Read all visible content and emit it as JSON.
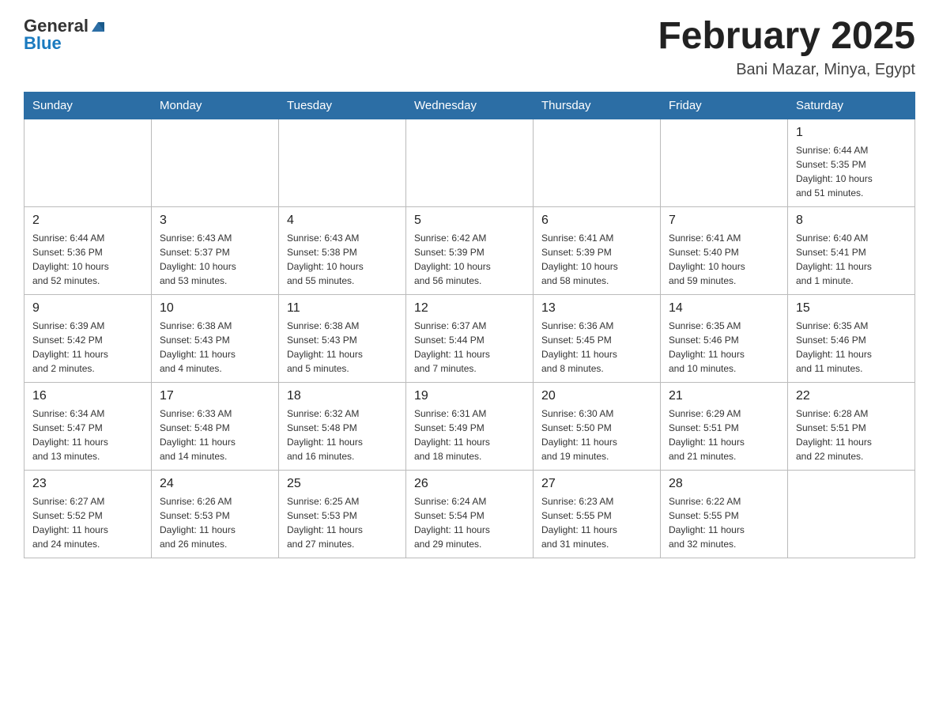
{
  "header": {
    "logo_general": "General",
    "logo_blue": "Blue",
    "title": "February 2025",
    "location": "Bani Mazar, Minya, Egypt"
  },
  "weekdays": [
    "Sunday",
    "Monday",
    "Tuesday",
    "Wednesday",
    "Thursday",
    "Friday",
    "Saturday"
  ],
  "weeks": [
    [
      {
        "day": "",
        "info": ""
      },
      {
        "day": "",
        "info": ""
      },
      {
        "day": "",
        "info": ""
      },
      {
        "day": "",
        "info": ""
      },
      {
        "day": "",
        "info": ""
      },
      {
        "day": "",
        "info": ""
      },
      {
        "day": "1",
        "info": "Sunrise: 6:44 AM\nSunset: 5:35 PM\nDaylight: 10 hours\nand 51 minutes."
      }
    ],
    [
      {
        "day": "2",
        "info": "Sunrise: 6:44 AM\nSunset: 5:36 PM\nDaylight: 10 hours\nand 52 minutes."
      },
      {
        "day": "3",
        "info": "Sunrise: 6:43 AM\nSunset: 5:37 PM\nDaylight: 10 hours\nand 53 minutes."
      },
      {
        "day": "4",
        "info": "Sunrise: 6:43 AM\nSunset: 5:38 PM\nDaylight: 10 hours\nand 55 minutes."
      },
      {
        "day": "5",
        "info": "Sunrise: 6:42 AM\nSunset: 5:39 PM\nDaylight: 10 hours\nand 56 minutes."
      },
      {
        "day": "6",
        "info": "Sunrise: 6:41 AM\nSunset: 5:39 PM\nDaylight: 10 hours\nand 58 minutes."
      },
      {
        "day": "7",
        "info": "Sunrise: 6:41 AM\nSunset: 5:40 PM\nDaylight: 10 hours\nand 59 minutes."
      },
      {
        "day": "8",
        "info": "Sunrise: 6:40 AM\nSunset: 5:41 PM\nDaylight: 11 hours\nand 1 minute."
      }
    ],
    [
      {
        "day": "9",
        "info": "Sunrise: 6:39 AM\nSunset: 5:42 PM\nDaylight: 11 hours\nand 2 minutes."
      },
      {
        "day": "10",
        "info": "Sunrise: 6:38 AM\nSunset: 5:43 PM\nDaylight: 11 hours\nand 4 minutes."
      },
      {
        "day": "11",
        "info": "Sunrise: 6:38 AM\nSunset: 5:43 PM\nDaylight: 11 hours\nand 5 minutes."
      },
      {
        "day": "12",
        "info": "Sunrise: 6:37 AM\nSunset: 5:44 PM\nDaylight: 11 hours\nand 7 minutes."
      },
      {
        "day": "13",
        "info": "Sunrise: 6:36 AM\nSunset: 5:45 PM\nDaylight: 11 hours\nand 8 minutes."
      },
      {
        "day": "14",
        "info": "Sunrise: 6:35 AM\nSunset: 5:46 PM\nDaylight: 11 hours\nand 10 minutes."
      },
      {
        "day": "15",
        "info": "Sunrise: 6:35 AM\nSunset: 5:46 PM\nDaylight: 11 hours\nand 11 minutes."
      }
    ],
    [
      {
        "day": "16",
        "info": "Sunrise: 6:34 AM\nSunset: 5:47 PM\nDaylight: 11 hours\nand 13 minutes."
      },
      {
        "day": "17",
        "info": "Sunrise: 6:33 AM\nSunset: 5:48 PM\nDaylight: 11 hours\nand 14 minutes."
      },
      {
        "day": "18",
        "info": "Sunrise: 6:32 AM\nSunset: 5:48 PM\nDaylight: 11 hours\nand 16 minutes."
      },
      {
        "day": "19",
        "info": "Sunrise: 6:31 AM\nSunset: 5:49 PM\nDaylight: 11 hours\nand 18 minutes."
      },
      {
        "day": "20",
        "info": "Sunrise: 6:30 AM\nSunset: 5:50 PM\nDaylight: 11 hours\nand 19 minutes."
      },
      {
        "day": "21",
        "info": "Sunrise: 6:29 AM\nSunset: 5:51 PM\nDaylight: 11 hours\nand 21 minutes."
      },
      {
        "day": "22",
        "info": "Sunrise: 6:28 AM\nSunset: 5:51 PM\nDaylight: 11 hours\nand 22 minutes."
      }
    ],
    [
      {
        "day": "23",
        "info": "Sunrise: 6:27 AM\nSunset: 5:52 PM\nDaylight: 11 hours\nand 24 minutes."
      },
      {
        "day": "24",
        "info": "Sunrise: 6:26 AM\nSunset: 5:53 PM\nDaylight: 11 hours\nand 26 minutes."
      },
      {
        "day": "25",
        "info": "Sunrise: 6:25 AM\nSunset: 5:53 PM\nDaylight: 11 hours\nand 27 minutes."
      },
      {
        "day": "26",
        "info": "Sunrise: 6:24 AM\nSunset: 5:54 PM\nDaylight: 11 hours\nand 29 minutes."
      },
      {
        "day": "27",
        "info": "Sunrise: 6:23 AM\nSunset: 5:55 PM\nDaylight: 11 hours\nand 31 minutes."
      },
      {
        "day": "28",
        "info": "Sunrise: 6:22 AM\nSunset: 5:55 PM\nDaylight: 11 hours\nand 32 minutes."
      },
      {
        "day": "",
        "info": ""
      }
    ]
  ]
}
